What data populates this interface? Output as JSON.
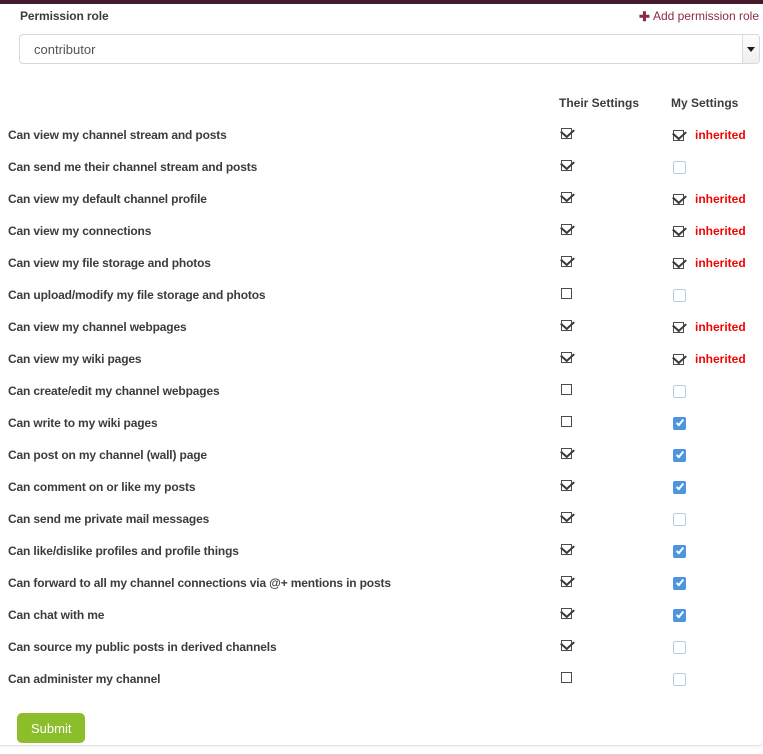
{
  "theme": {
    "top_bar_color": "#451a2e",
    "link_color": "#8b2b4a",
    "inherited_color": "#f00505",
    "checkbox_on_color": "#4f94e0",
    "submit_color": "#8cbe2b"
  },
  "header": {
    "title": "Permission role",
    "add_link_label": "Add permission role",
    "add_link_icon": "plus-icon"
  },
  "role_select": {
    "selected": "contributor",
    "options": [
      "contributor"
    ],
    "icon": "chevron-down-icon"
  },
  "table": {
    "columns": {
      "label": "",
      "their_settings": "Their Settings",
      "my_settings": "My Settings"
    },
    "rows": [
      {
        "label": "Can view my channel stream and posts",
        "their": "checked",
        "mine": "checked-static",
        "inherited": "inherited"
      },
      {
        "label": "Can send me their channel stream and posts",
        "their": "checked",
        "mine": "off",
        "inherited": ""
      },
      {
        "label": "Can view my default channel profile",
        "their": "checked",
        "mine": "checked-static",
        "inherited": "inherited"
      },
      {
        "label": "Can view my connections",
        "their": "checked",
        "mine": "checked-static",
        "inherited": "inherited"
      },
      {
        "label": "Can view my file storage and photos",
        "their": "checked",
        "mine": "checked-static",
        "inherited": "inherited"
      },
      {
        "label": "Can upload/modify my file storage and photos",
        "their": "unchecked",
        "mine": "off",
        "inherited": ""
      },
      {
        "label": "Can view my channel webpages",
        "their": "checked",
        "mine": "checked-static",
        "inherited": "inherited"
      },
      {
        "label": "Can view my wiki pages",
        "their": "checked",
        "mine": "checked-static",
        "inherited": "inherited"
      },
      {
        "label": "Can create/edit my channel webpages",
        "their": "unchecked",
        "mine": "off",
        "inherited": ""
      },
      {
        "label": "Can write to my wiki pages",
        "their": "unchecked",
        "mine": "on",
        "inherited": ""
      },
      {
        "label": "Can post on my channel (wall) page",
        "their": "checked",
        "mine": "on",
        "inherited": ""
      },
      {
        "label": "Can comment on or like my posts",
        "their": "checked",
        "mine": "on",
        "inherited": ""
      },
      {
        "label": "Can send me private mail messages",
        "their": "checked",
        "mine": "off",
        "inherited": ""
      },
      {
        "label": "Can like/dislike profiles and profile things",
        "their": "checked",
        "mine": "on",
        "inherited": ""
      },
      {
        "label": "Can forward to all my channel connections via @+ mentions in posts",
        "their": "checked",
        "mine": "on",
        "inherited": ""
      },
      {
        "label": "Can chat with me",
        "their": "checked",
        "mine": "on",
        "inherited": ""
      },
      {
        "label": "Can source my public posts in derived channels",
        "their": "checked",
        "mine": "off",
        "inherited": ""
      },
      {
        "label": "Can administer my channel",
        "their": "unchecked",
        "mine": "off",
        "inherited": ""
      }
    ]
  },
  "submit": {
    "label": "Submit"
  }
}
